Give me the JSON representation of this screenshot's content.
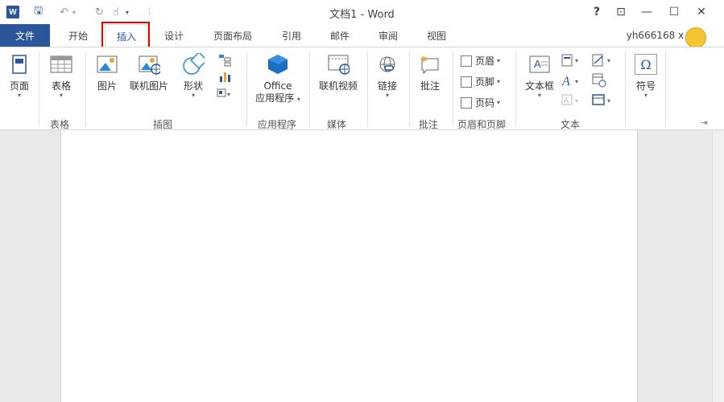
{
  "window": {
    "title": "文档1 - Word",
    "help": "?",
    "ribbon_display": "⊡",
    "minimize": "—",
    "maximize": "☐",
    "close": "✕"
  },
  "qat": {
    "word": "W",
    "save": "🖫",
    "undo": "↶",
    "undo_caret": "▾",
    "redo": "↻",
    "touch": "☝",
    "touch_caret": "▾",
    "customize": "⫶"
  },
  "tabs": [
    {
      "label": "文件"
    },
    {
      "label": "开始"
    },
    {
      "label": "插入"
    },
    {
      "label": "设计"
    },
    {
      "label": "页面布局"
    },
    {
      "label": "引用"
    },
    {
      "label": "邮件"
    },
    {
      "label": "审阅"
    },
    {
      "label": "视图"
    }
  ],
  "user": {
    "name": "yh666168 x",
    "caret": "▾"
  },
  "ribbon": {
    "pages": {
      "label": "页面",
      "group": ""
    },
    "table": {
      "label": "表格",
      "group": "表格"
    },
    "pictures": {
      "label": "图片"
    },
    "online_pictures": {
      "label": "联机图片"
    },
    "shapes": {
      "label": "形状"
    },
    "illustrations_group": "插图",
    "office_apps": {
      "line1": "Office",
      "line2": "应用程序",
      "group": "应用程序"
    },
    "online_video": {
      "label": "联机视频",
      "group": "媒体"
    },
    "links": {
      "label": "链接"
    },
    "comment": {
      "label": "批注",
      "group": "批注"
    },
    "header": {
      "label": "页眉"
    },
    "footer": {
      "label": "页脚"
    },
    "page_number": {
      "label": "页码"
    },
    "header_footer_group": "页眉和页脚",
    "textbox": {
      "label": "文本框"
    },
    "text_group": "文本",
    "symbol": {
      "label": "符号",
      "glyph": "Ω"
    },
    "caret": "▾",
    "pin": "⇥"
  },
  "colors": {
    "accent": "#2b579a",
    "highlight": "#ee0000"
  }
}
